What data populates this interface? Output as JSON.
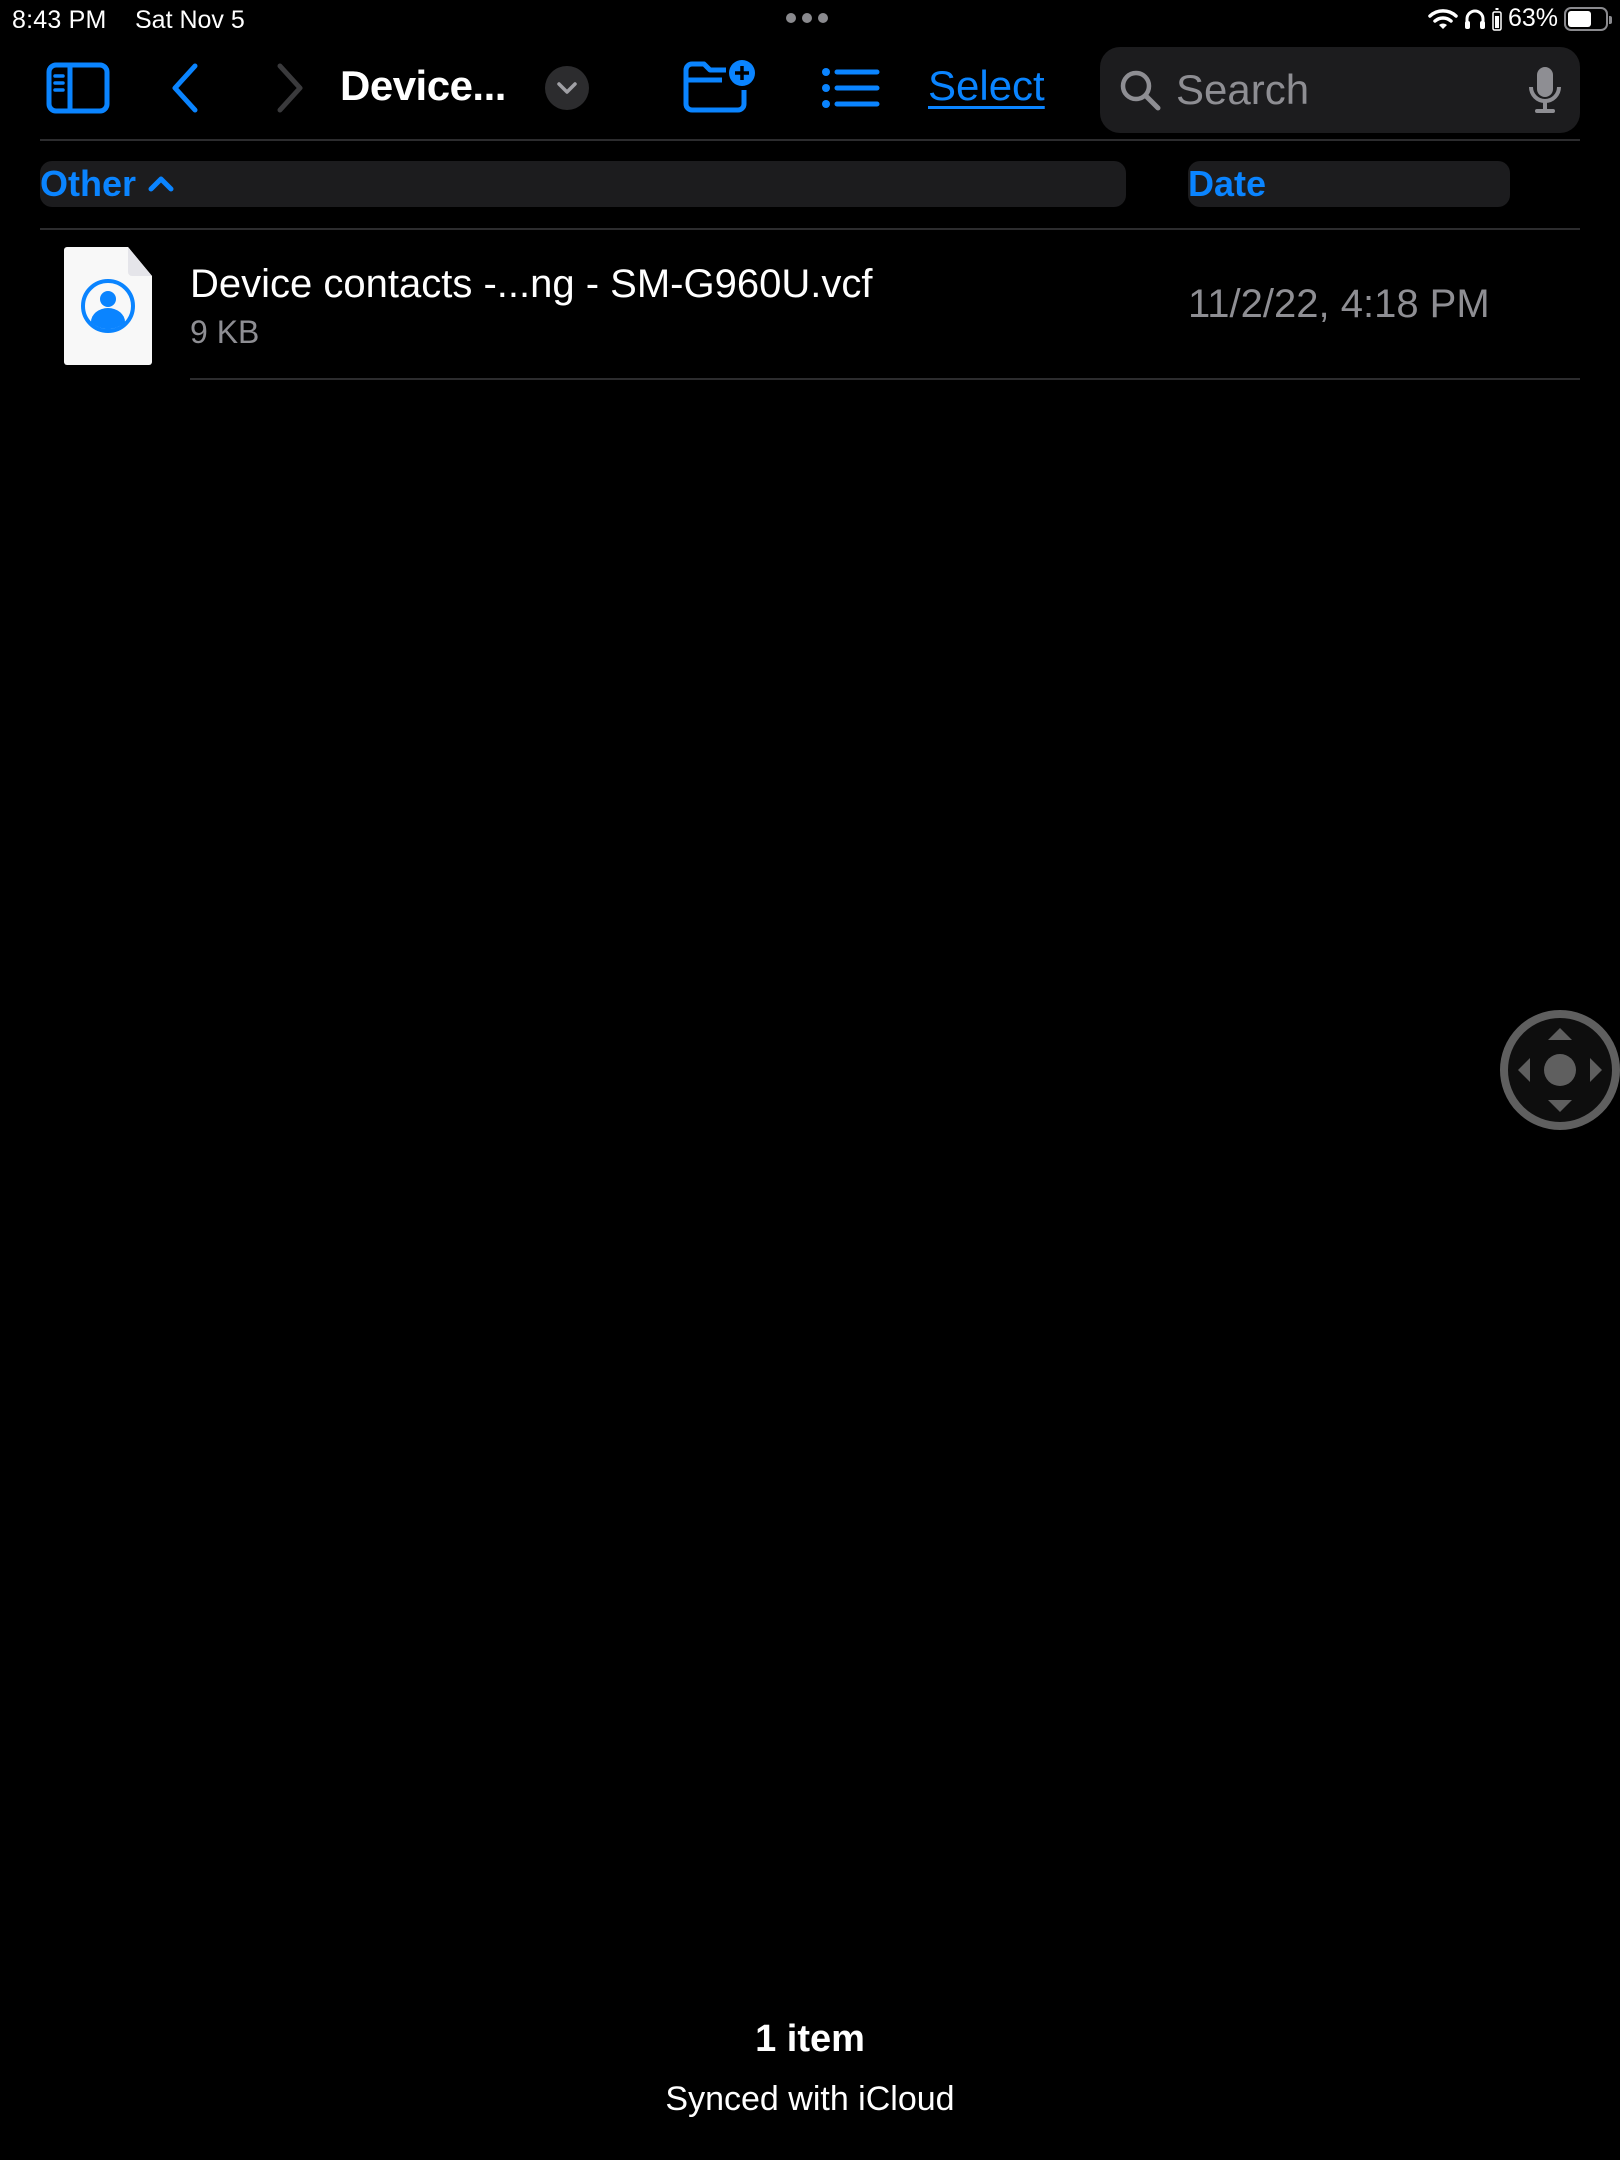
{
  "status_bar": {
    "time": "8:43 PM",
    "date": "Sat Nov 5",
    "battery_percent": "63%",
    "battery_level": 0.63,
    "icons": [
      "wifi-icon",
      "headphones-icon",
      "headphone-battery-icon",
      "battery-icon"
    ]
  },
  "toolbar": {
    "title": "Device...",
    "select_label": "Select",
    "icons": [
      "sidebar-toggle-icon",
      "chevron-left-icon",
      "chevron-right-icon",
      "chevron-down-icon",
      "new-folder-icon",
      "list-view-icon",
      "search-icon",
      "microphone-icon"
    ]
  },
  "search": {
    "placeholder": "Search",
    "value": ""
  },
  "columns": {
    "name_header": "Other",
    "name_sort_icon": "chevron-up-icon",
    "date_header": "Date"
  },
  "files": [
    {
      "name": "Device contacts -...ng - SM-G960U.vcf",
      "size": "9 KB",
      "date": "11/2/22, 4:18 PM",
      "icon": "contact-file-icon"
    }
  ],
  "footer": {
    "item_count": "1 item",
    "sync_status": "Synced with iCloud"
  },
  "colors": {
    "accent": "#0a84ff",
    "background": "#000000",
    "secondary_text": "#8e8e93",
    "field_background": "#1c1c1e"
  }
}
